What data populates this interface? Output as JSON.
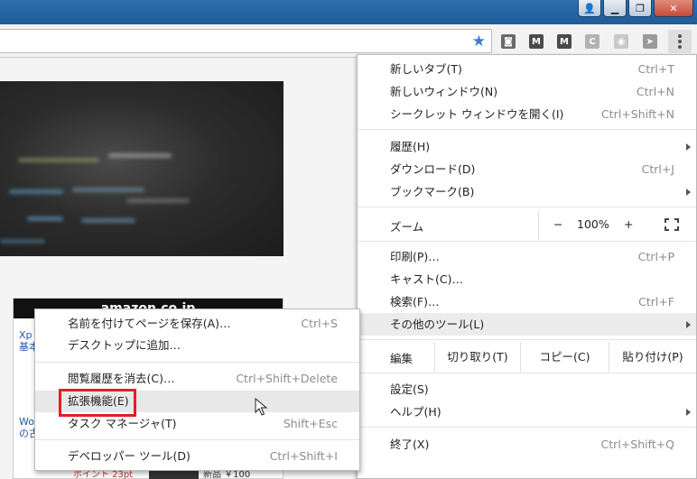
{
  "titlebar": {
    "buttons": [
      "user-icon",
      "minimize-icon",
      "restore-icon",
      "close-icon"
    ]
  },
  "toolbar": {
    "bookmark_icon": "star-icon",
    "extensions": [
      {
        "name": "ext-icon-1",
        "glyph": "◙",
        "color": "#6a6a6a"
      },
      {
        "name": "ext-icon-m1",
        "glyph": "M",
        "color": "#4a4a4a"
      },
      {
        "name": "ext-icon-m2",
        "glyph": "M",
        "color": "#4a4a4a"
      },
      {
        "name": "ext-icon-c",
        "glyph": "C",
        "color": "#b3b3b3"
      },
      {
        "name": "camera-icon",
        "glyph": "◉",
        "color": "#c8c8c8"
      },
      {
        "name": "cursor-ext-icon",
        "glyph": "➤",
        "color": "#9a9a9a"
      }
    ]
  },
  "menu": {
    "new_tab": {
      "label": "新しいタブ(T)",
      "shortcut": "Ctrl+T"
    },
    "new_window": {
      "label": "新しいウィンドウ(N)",
      "shortcut": "Ctrl+N"
    },
    "incognito": {
      "label": "シークレット ウィンドウを開く(I)",
      "shortcut": "Ctrl+Shift+N"
    },
    "history": {
      "label": "履歴(H)"
    },
    "downloads": {
      "label": "ダウンロード(D)",
      "shortcut": "Ctrl+J"
    },
    "bookmarks": {
      "label": "ブックマーク(B)"
    },
    "zoom": {
      "label": "ズーム",
      "minus": "−",
      "value": "100%",
      "plus": "+"
    },
    "print": {
      "label": "印刷(P)…",
      "shortcut": "Ctrl+P"
    },
    "cast": {
      "label": "キャスト(C)…"
    },
    "find": {
      "label": "検索(F)…",
      "shortcut": "Ctrl+F"
    },
    "more_tools": {
      "label": "その他のツール(L)"
    },
    "edit": {
      "label": "編集",
      "cut": "切り取り(T)",
      "copy": "コピー(C)",
      "paste": "貼り付け(P)"
    },
    "settings": {
      "label": "設定(S)"
    },
    "help": {
      "label": "ヘルプ(H)"
    },
    "exit": {
      "label": "終了(X)",
      "shortcut": "Ctrl+Shift+Q"
    }
  },
  "submenu": {
    "save_page": {
      "label": "名前を付けてページを保存(A)…",
      "shortcut": "Ctrl+S"
    },
    "add_to_desktop": {
      "label": "デスクトップに追加…"
    },
    "clear_history": {
      "label": "閲覧履歴を消去(C)…",
      "shortcut": "Ctrl+Shift+Delete"
    },
    "extensions": {
      "label": "拡張機能(E)"
    },
    "task_manager": {
      "label": "タスク マネージャ(T)",
      "shortcut": "Shift+Esc"
    },
    "devtools": {
      "label": "デベロッパー ツール(D)",
      "shortcut": "Ctrl+Shift+I"
    }
  },
  "page": {
    "ad": {
      "header": "amazon.co.jp",
      "side_1": "Xp",
      "side_2": "基本",
      "side_3": "Wo",
      "side_4": "の古",
      "points": "ポイント 23pt",
      "price": "新品 ￥100"
    }
  }
}
